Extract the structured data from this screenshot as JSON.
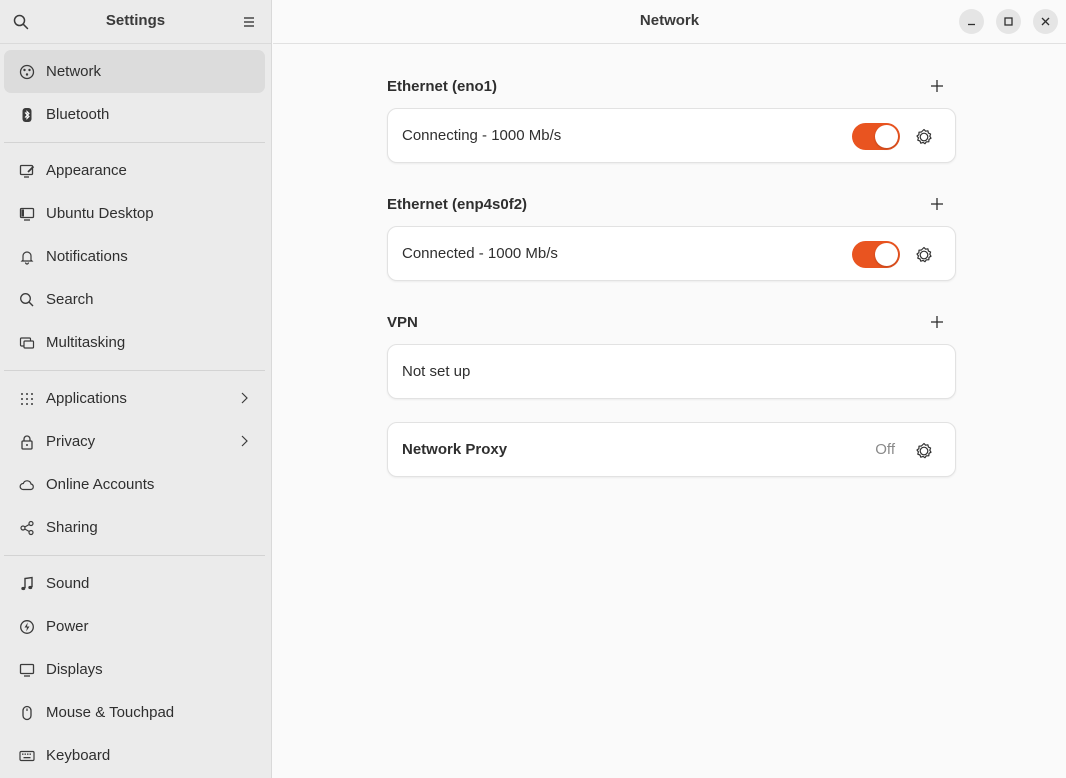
{
  "sidebar": {
    "title": "Settings",
    "groups": [
      [
        {
          "label": "Network",
          "icon": "network-icon",
          "active": true
        },
        {
          "label": "Bluetooth",
          "icon": "bluetooth-icon"
        }
      ],
      [
        {
          "label": "Appearance",
          "icon": "appearance-icon"
        },
        {
          "label": "Ubuntu Desktop",
          "icon": "ubuntu-desktop-icon"
        },
        {
          "label": "Notifications",
          "icon": "bell-icon"
        },
        {
          "label": "Search",
          "icon": "search-icon"
        },
        {
          "label": "Multitasking",
          "icon": "multitasking-icon"
        }
      ],
      [
        {
          "label": "Applications",
          "icon": "apps-grid-icon",
          "chevron": true
        },
        {
          "label": "Privacy",
          "icon": "lock-icon",
          "chevron": true
        },
        {
          "label": "Online Accounts",
          "icon": "cloud-icon"
        },
        {
          "label": "Sharing",
          "icon": "share-icon"
        }
      ],
      [
        {
          "label": "Sound",
          "icon": "music-note-icon"
        },
        {
          "label": "Power",
          "icon": "power-icon"
        },
        {
          "label": "Displays",
          "icon": "display-icon"
        },
        {
          "label": "Mouse & Touchpad",
          "icon": "mouse-icon"
        },
        {
          "label": "Keyboard",
          "icon": "keyboard-icon"
        }
      ]
    ]
  },
  "header": {
    "title": "Network"
  },
  "sections": {
    "eno1": {
      "title": "Ethernet (eno1)",
      "status": "Connecting - 1000 Mb/s",
      "enabled": true
    },
    "enp4s0f2": {
      "title": "Ethernet (enp4s0f2)",
      "status": "Connected - 1000 Mb/s",
      "enabled": true
    },
    "vpn": {
      "title": "VPN",
      "status": "Not set up"
    },
    "proxy": {
      "title": "Network Proxy",
      "status": "Off"
    }
  },
  "colors": {
    "accent": "#e95420",
    "sidebar_bg": "#ebebeb",
    "content_bg": "#fafafa"
  }
}
